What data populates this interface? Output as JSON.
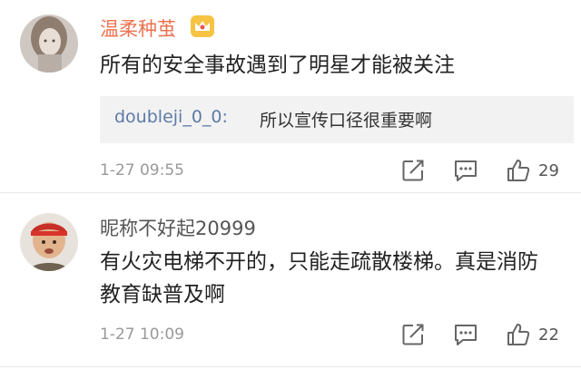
{
  "comments": [
    {
      "username": "温柔种茧",
      "text": "所有的安全事故遇到了明星才能被关注",
      "reply": {
        "name": "doubleji_0_0:",
        "text": "所以宣传口径很重要啊"
      },
      "time": "1-27 09:55",
      "likes": "29",
      "badge_icon": "crown-icon",
      "name_color": "#eb7350"
    },
    {
      "username": "昵称不好起20999",
      "text": "有火灾电梯不开的，只能走疏散楼梯。真是消防教育缺普及啊",
      "time": "1-27 10:09",
      "likes": "22",
      "name_color": "#555555"
    }
  ],
  "icons": {
    "forward": "share-edit-icon",
    "reply": "comment-icon",
    "like": "thumbs-up-icon"
  }
}
